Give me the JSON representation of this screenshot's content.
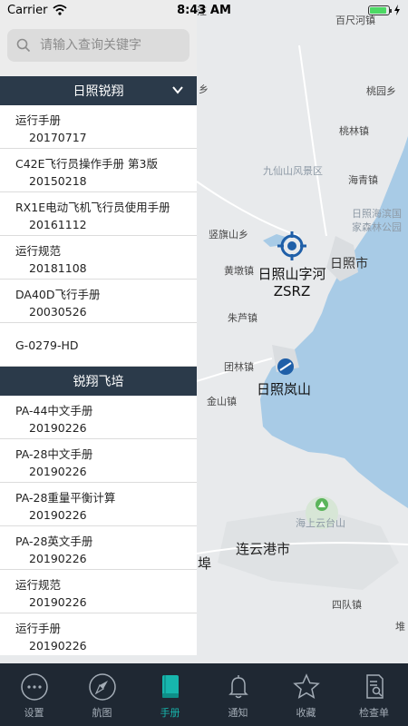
{
  "status_bar": {
    "carrier": "Carrier",
    "time": "8:43 AM"
  },
  "search": {
    "placeholder": "请输入查询关键字"
  },
  "groups": [
    {
      "name": "日照锐翔",
      "items": [
        {
          "title": "运行手册",
          "date": "20170717"
        },
        {
          "title": "C42E飞行员操作手册 第3版",
          "date": "20150218"
        },
        {
          "title": "RX1E电动飞机飞行员使用手册",
          "date": "20161112"
        },
        {
          "title": "运行规范",
          "date": "20181108"
        },
        {
          "title": "DA40D飞行手册",
          "date": "20030526"
        },
        {
          "title": "G-0279-HD",
          "date": ""
        }
      ]
    },
    {
      "name": "锐翔飞培",
      "items": [
        {
          "title": "PA-44中文手册",
          "date": "20190226"
        },
        {
          "title": "PA-28中文手册",
          "date": "20190226"
        },
        {
          "title": "PA-28重量平衡计算",
          "date": "20190226"
        },
        {
          "title": "PA-28英文手册",
          "date": "20190226"
        },
        {
          "title": "运行规范",
          "date": "20190226"
        },
        {
          "title": "运行手册",
          "date": "20190226"
        }
      ]
    }
  ],
  "map": {
    "labels": {
      "baichihezhen": "百尺河镇",
      "taoyuanxiang": "桃园乡",
      "taolinzhen": "桃林镇",
      "jiuxianshan": "九仙山风景区",
      "haiqingzhen": "海青镇",
      "haibin": "日照海滨国家森林公园",
      "xiang": "乡",
      "shuqishan": "竖旗山乡",
      "rizhaoshi": "日照市",
      "huangdunzhen": "黄墩镇",
      "zhutingzhen": "朱芦镇",
      "tuanlinzhen": "团林镇",
      "jinshanzhen": "金山镇",
      "haishangyuntaishan": "海上云台山",
      "lianyungangshi": "连云港市",
      "bu": "埠",
      "siduizhen": "四队镇",
      "dui": "堆",
      "top_partial": "柘汪"
    },
    "airports": [
      {
        "name": "日照山字河",
        "code": "ZSRZ"
      },
      {
        "name": "日照岚山",
        "code": ""
      }
    ]
  },
  "tabs": [
    {
      "label": "设置",
      "icon": "settings-dots-icon",
      "active": false
    },
    {
      "label": "航图",
      "icon": "compass-icon",
      "active": false
    },
    {
      "label": "手册",
      "icon": "book-icon",
      "active": true
    },
    {
      "label": "通知",
      "icon": "bell-icon",
      "active": false
    },
    {
      "label": "收藏",
      "icon": "star-icon",
      "active": false
    },
    {
      "label": "检查单",
      "icon": "checklist-icon",
      "active": false
    }
  ],
  "colors": {
    "panel_header": "#2b3a4a",
    "tab_bar": "#1f2833",
    "tab_active": "#17b6ad",
    "water": "#a8cbe6",
    "land": "#e8eaec"
  }
}
